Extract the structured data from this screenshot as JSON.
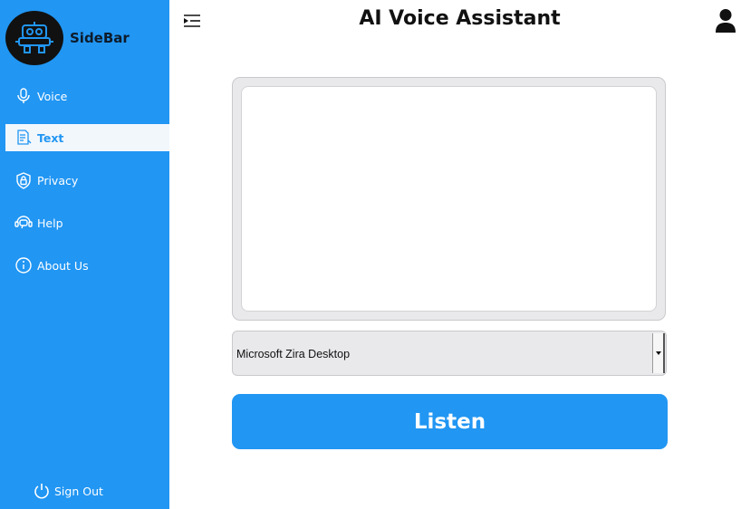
{
  "sidebar": {
    "brand": "SideBar",
    "items": [
      {
        "label": "Voice",
        "icon": "microphone-icon"
      },
      {
        "label": "Text",
        "icon": "text-document-icon",
        "active": true
      },
      {
        "label": "Privacy",
        "icon": "shield-lock-icon"
      },
      {
        "label": "Help",
        "icon": "chat-support-icon"
      },
      {
        "label": "About Us",
        "icon": "info-icon"
      }
    ],
    "sign_out": "Sign Out"
  },
  "header": {
    "title": "AI Voice Assistant"
  },
  "main": {
    "text_value": "",
    "voice_select": {
      "selected": "Microsoft Zira Desktop"
    },
    "listen_label": "Listen"
  },
  "colors": {
    "accent": "#2196f3",
    "sidebar_active_bg": "#f2f7fc"
  }
}
